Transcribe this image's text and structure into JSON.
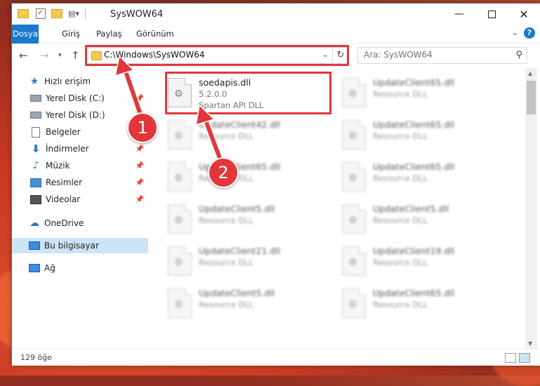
{
  "window": {
    "title": "SysWOW64"
  },
  "ribbon": {
    "tabs": [
      "Dosya",
      "Giriş",
      "Paylaş",
      "Görünüm"
    ]
  },
  "nav": {
    "address": "C:\\Windows\\SysWOW64",
    "search_placeholder": "Ara: SysWOW64"
  },
  "sidebar": {
    "quick_access": "Hızlı erişim",
    "items": [
      {
        "label": "Yerel Disk (C:)",
        "icon": "drive-icon"
      },
      {
        "label": "Yerel Disk (D:)",
        "icon": "drive-icon"
      },
      {
        "label": "Belgeler",
        "icon": "documents-icon"
      },
      {
        "label": "İndirmeler",
        "icon": "downloads-icon"
      },
      {
        "label": "Müzik",
        "icon": "music-icon"
      },
      {
        "label": "Resimler",
        "icon": "pictures-icon"
      },
      {
        "label": "Videolar",
        "icon": "videos-icon"
      }
    ],
    "onedrive": "OneDrive",
    "this_pc": "Bu bilgisayar",
    "network": "Ağ"
  },
  "files": [
    {
      "name": "soedapis.dll",
      "line1": "5.2.0.0",
      "line2": "Spartan API DLL"
    },
    {
      "name": "UpdateClient65.dll",
      "line1": "Resource DLL",
      "line2": ""
    },
    {
      "name": "UpdateClient42.dll",
      "line1": "Resource DLL",
      "line2": ""
    },
    {
      "name": "UpdateClient65.dll",
      "line1": "Resource DLL",
      "line2": ""
    },
    {
      "name": "UpdateClient65.dll",
      "line1": "Resource DLL",
      "line2": ""
    },
    {
      "name": "UpdateClient65.dll",
      "line1": "Resource DLL",
      "line2": ""
    },
    {
      "name": "UpdateClient5.dll",
      "line1": "Resource DLL",
      "line2": ""
    },
    {
      "name": "UpdateClient5.dll",
      "line1": "Resource DLL",
      "line2": ""
    },
    {
      "name": "UpdateClient21.dll",
      "line1": "Resource DLL",
      "line2": ""
    },
    {
      "name": "UpdateClient19.dll",
      "line1": "Resource DLL",
      "line2": ""
    },
    {
      "name": "UpdateClient5.dll",
      "line1": "Resource DLL",
      "line2": ""
    },
    {
      "name": "UpdateClient65.dll",
      "line1": "Resource DLL",
      "line2": ""
    }
  ],
  "status": {
    "count": "129 öğe"
  },
  "annotations": {
    "badge1": "1",
    "badge2": "2",
    "color": "#e1373b"
  },
  "colors": {
    "accent": "#1979ca",
    "selected": "#cce4f7"
  }
}
